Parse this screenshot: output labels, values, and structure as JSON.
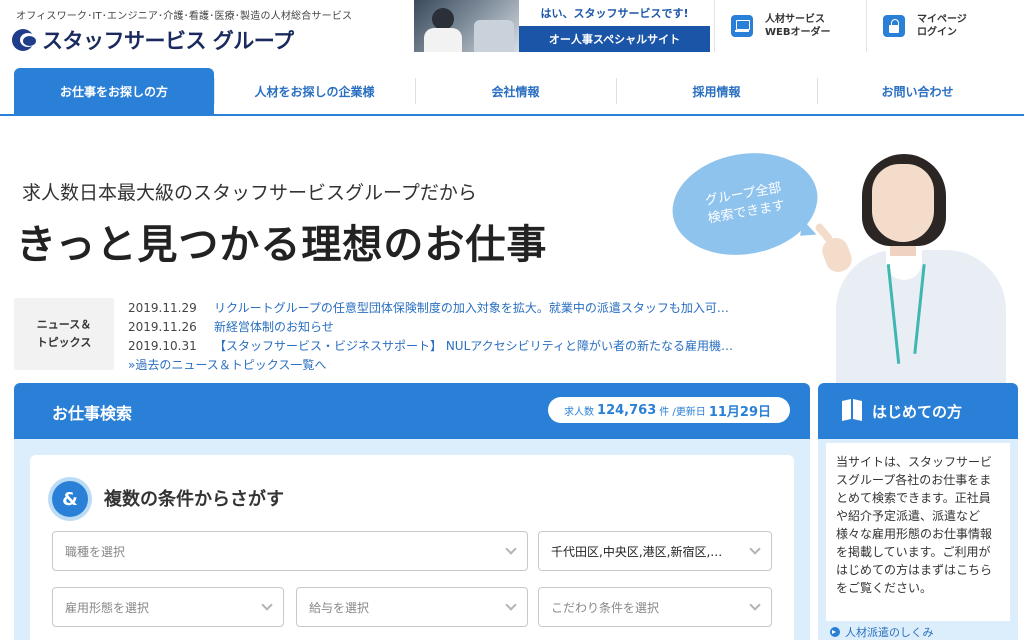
{
  "header": {
    "tagline": "オフィスワーク･IT･エンジニア･介護･看護･医療･製造の人材総合サービス",
    "logo_text": "スタッフサービス グループ",
    "banner_top": "はい、スタッフサービスです!",
    "banner_bottom": "オー人事スペシャルサイト",
    "web_order_line1": "人材サービス",
    "web_order_line2": "WEBオーダー",
    "mypage_line1": "マイページ",
    "mypage_line2": "ログイン"
  },
  "nav": {
    "items": [
      {
        "label": "お仕事をお探しの方"
      },
      {
        "label": "人材をお探しの企業様"
      },
      {
        "label": "会社情報"
      },
      {
        "label": "採用情報"
      },
      {
        "label": "お問い合わせ"
      }
    ]
  },
  "hero": {
    "subtitle": "求人数日本最大級のスタッフサービスグループだから",
    "title": "きっと見つかる理想のお仕事",
    "bubble_line1": "グループ全部",
    "bubble_line2": "検索できます"
  },
  "news": {
    "label_line1": "ニュース＆",
    "label_line2": "トピックス",
    "items": [
      {
        "date": "2019.11.29",
        "title": "リクルートグループの任意型団体保険制度の加入対象を拡大。就業中の派遣スタッフも加入可…"
      },
      {
        "date": "2019.11.26",
        "title": "新経営体制のお知らせ"
      },
      {
        "date": "2019.10.31",
        "title": "【スタッフサービス・ビジネスサポート】 NULアクセシビリティと障がい者の新たなる雇用機…"
      }
    ],
    "more_link": "»過去のニュース＆トピックス一覧へ"
  },
  "search": {
    "title": "お仕事検索",
    "job_count_label": "求人数",
    "job_count": "124,763",
    "job_count_unit": "件 / ",
    "updated_label": "更新日",
    "updated_date": "11月29日",
    "amp_glyph": "&",
    "conditions_title": "複数の条件からさがす",
    "fields": {
      "job_type": "職種を選択",
      "area": "千代田区,中央区,港区,新宿区,…",
      "employment": "雇用形態を選択",
      "salary": "給与を選択",
      "preference": "こだわり条件を選択"
    }
  },
  "guide": {
    "title": "はじめての方",
    "text": "当サイトは、スタッフサービスグループ各社のお仕事をまとめて検索できます。正社員や紹介予定派遣、派遣など様々な雇用形態のお仕事情報を掲載しています。ご利用がはじめての方はまずはこちらをご覧ください。",
    "link": "人材派遣のしくみ"
  },
  "colors": {
    "primary": "#2a80d6",
    "light_bg": "#dceefb",
    "logo_navy": "#1a2a5e"
  }
}
